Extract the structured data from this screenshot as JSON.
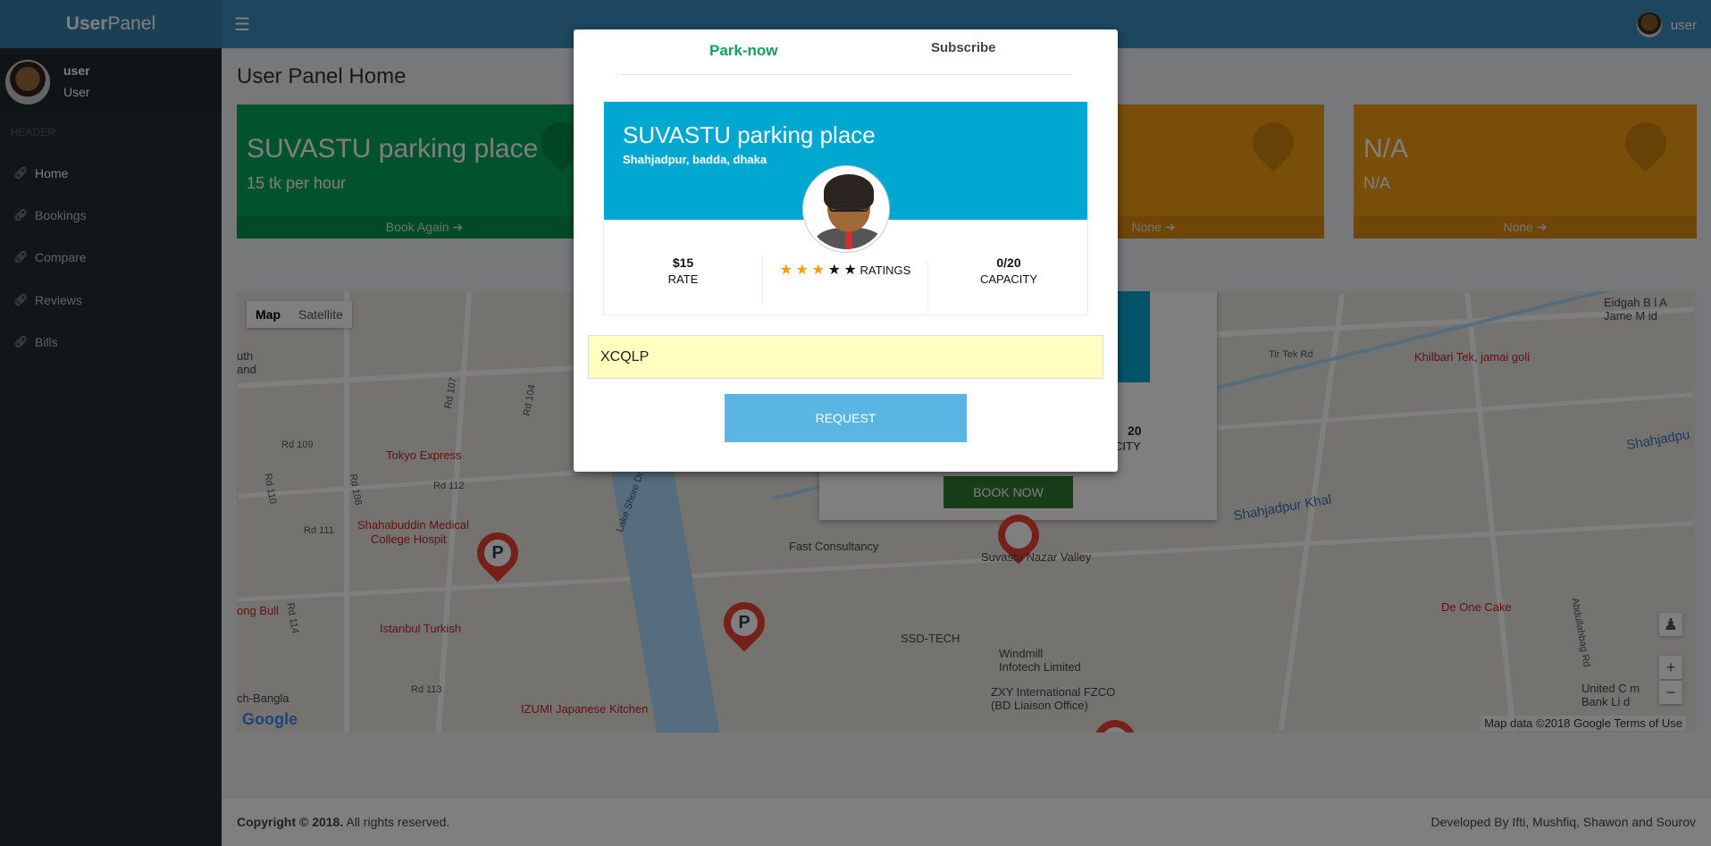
{
  "header": {
    "logo_bold": "User",
    "logo_rest": "Panel",
    "menu_icon": "☰",
    "username": "user"
  },
  "sidebar": {
    "user_name": "user",
    "user_role": "User",
    "section_header": "HEADER",
    "items": [
      {
        "label": "Home",
        "icon": "link-icon"
      },
      {
        "label": "Bookings",
        "icon": "link-icon"
      },
      {
        "label": "Compare",
        "icon": "link-icon"
      },
      {
        "label": "Reviews",
        "icon": "link-icon"
      },
      {
        "label": "Bills",
        "icon": "link-icon"
      }
    ]
  },
  "main": {
    "page_title": "User Panel Home",
    "boxes": [
      {
        "title": "SUVASTU parking place",
        "subtitle": "15 tk per hour",
        "footer": "Book Again",
        "color": "#00a65a"
      },
      {
        "title": "",
        "subtitle": "",
        "footer": "None",
        "color": "#f39c12"
      },
      {
        "title": "N/A",
        "subtitle": "N/A",
        "footer": "None",
        "color": "#f39c12"
      }
    ]
  },
  "map": {
    "type_buttons": [
      "Map",
      "Satellite"
    ],
    "labels": {
      "tokyo": "Tokyo Express",
      "shahabuddin": "Shahabuddin Medical",
      "shahabuddin2": "College Hospit",
      "istanbul": "Istanbul Turkish",
      "izumi": "IZUMI Japanese Kitchen",
      "fast": "Fast Consultancy",
      "nazar": "Suvastu Nazar Valley",
      "ssd": "SSD-TECH",
      "windmill": "Windmill",
      "windmill2": "Infotech Limited",
      "zxy": "ZXY International FZCO",
      "zxy2": "(BD Liaison Office)",
      "khal": "Shahjadpur Khal",
      "khal2": "Shahjadpu",
      "khilbari": "Khilbari Tek, jamai goli",
      "deone": "De One Cake",
      "eidgah": "Eidgah B    l A",
      "eidgah2": "Jame M    id",
      "ongbull": "ong Bull",
      "bangla": "ch-Bangla",
      "united": "United C    m",
      "united2": "Bank Li    d",
      "lake": "Lake Shore Dr",
      "rd107": "Rd 107",
      "rd104": "Rd 104",
      "rd109": "Rd 109",
      "rd110": "Rd 110",
      "rd108": "Rd 108",
      "rd112": "Rd 112",
      "rd111": "Rd 111",
      "rd114": "Rd 114",
      "rd113": "Rd 113",
      "tirtek": "Tir Tek Rd",
      "abdul": "Abdullahbag Rd",
      "auth": "uth",
      "aand": "and"
    },
    "info_window": {
      "capacity_value": "20",
      "capacity_label": "CITY",
      "book_now": "BOOK NOW"
    },
    "pin_letter": "P",
    "zoom_in": "+",
    "zoom_out": "−",
    "google": "Google",
    "attribution": "Map data ©2018 Google    Terms of Use"
  },
  "footer": {
    "copyright_bold": "Copyright © 2018.",
    "copyright_rest": " All rights reserved.",
    "credits": "Developed By Ifti, Mushfiq, Shawon and Sourov"
  },
  "modal": {
    "tabs": [
      "Park-now",
      "Subscribe"
    ],
    "active_tab": "Park-now",
    "card": {
      "title": "SUVASTU parking place",
      "address": "Shahjadpur, badda, dhaka",
      "rate_value": "$15",
      "rate_label": "RATE",
      "rating_stars": 3,
      "rating_max": 5,
      "rating_label": "RATINGS",
      "capacity_value": "0/20",
      "capacity_label": "CAPACITY"
    },
    "code_value": "XCQLP",
    "request_button": "REQUEST"
  }
}
